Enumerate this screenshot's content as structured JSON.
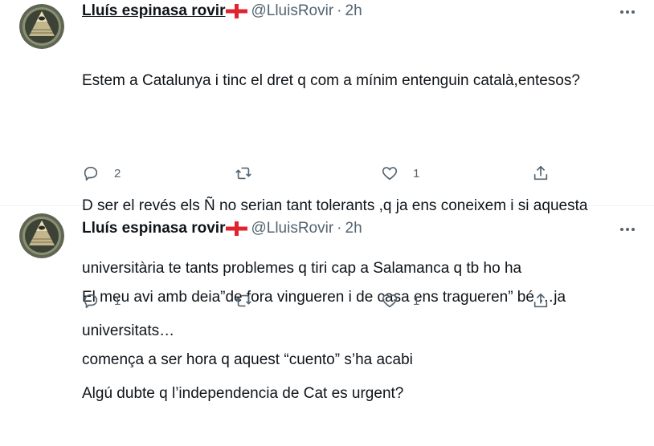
{
  "tweets": [
    {
      "author_name": "Lluís espinasa rovir",
      "handle": "@LluisRovir",
      "separator": "·",
      "time": "2h",
      "text_lines": [
        "Estem a Catalunya i tinc el dret q com a mínim entenguin català,entesos?",
        "",
        "D ser el revés els Ñ no serian tant tolerants ,q ja ens coneixem i si aquesta",
        "universitària te tants problemes q tiri cap a Salamanca q tb ho ha",
        "universitats…",
        "Algú dubte q l’independencia de Cat es urgent?"
      ],
      "reply_count": "2",
      "retweet_count": "",
      "like_count": "1"
    },
    {
      "author_name": "Lluís espinasa rovir",
      "handle": "@LluisRovir",
      "separator": "·",
      "time": "2h",
      "text_lines": [
        "El meu avi amb deia”de fora vingueren i de casa ens tragueren” bé …ja",
        "comença a ser hora q aquest “cuento” s’ha acabi"
      ],
      "reply_count": "1",
      "retweet_count": "",
      "like_count": "1"
    }
  ],
  "icons": {
    "more": "more-dots-icon",
    "reply": "reply-bubble-icon",
    "retweet": "retweet-icon",
    "like": "heart-icon",
    "share": "share-icon",
    "avatar": "pyramid-eye-avatar",
    "flag": "england-flag-icon"
  },
  "colors": {
    "text": "#0f1419",
    "secondary": "#536471",
    "divider": "#eff3f4",
    "flag_red": "#e0242e"
  }
}
